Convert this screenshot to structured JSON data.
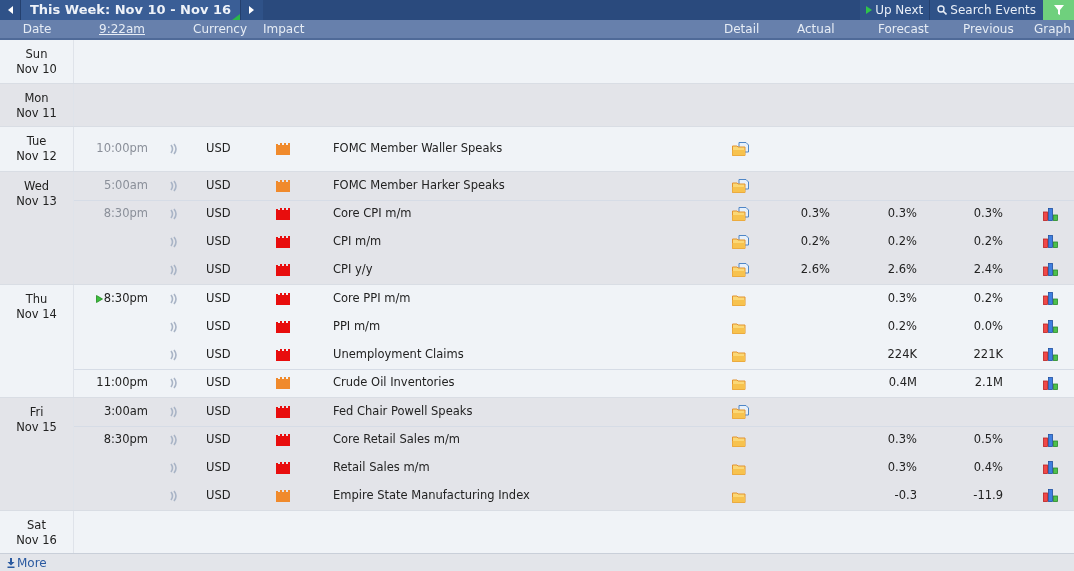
{
  "toolbar": {
    "week_label": "This Week: Nov 10 - Nov 16",
    "up_next": "Up Next",
    "search": "Search Events"
  },
  "columns": {
    "date": "Date",
    "time": "9:22am",
    "currency": "Currency",
    "impact": "Impact",
    "detail": "Detail",
    "actual": "Actual",
    "forecast": "Forecast",
    "previous": "Previous",
    "graph": "Graph"
  },
  "days": [
    {
      "day": "Sun",
      "date": "Nov 10"
    },
    {
      "day": "Mon",
      "date": "Nov 11"
    },
    {
      "day": "Tue",
      "date": "Nov 12",
      "events": [
        {
          "kind": "news",
          "time": "10:00pm",
          "past": true,
          "next": false,
          "currency": "USD",
          "color": "#f08a2c",
          "title": "FOMC Member Waller Speaks",
          "graph": false
        }
      ]
    },
    {
      "day": "Wed",
      "date": "Nov 13",
      "events": [
        {
          "kind": "news",
          "time": "5:00am",
          "past": true,
          "next": false,
          "currency": "USD",
          "color": "#f08a2c",
          "title": "FOMC Member Harker Speaks",
          "graph": false
        },
        {
          "kind": "news",
          "time": "8:30pm",
          "past": true,
          "next": false,
          "currency": "USD",
          "color": "#e80d0d",
          "title": "Core CPI m/m",
          "actual": "0.3%",
          "forecast": "0.3%",
          "previous": "0.3%",
          "graph": true
        },
        {
          "kind": "news",
          "next": false,
          "currency": "USD",
          "color": "#e80d0d",
          "title": "CPI m/m",
          "actual": "0.2%",
          "forecast": "0.2%",
          "previous": "0.2%",
          "graph": true
        },
        {
          "kind": "news",
          "next": false,
          "currency": "USD",
          "color": "#e80d0d",
          "title": "CPI y/y",
          "actual": "2.6%",
          "forecast": "2.6%",
          "previous": "2.4%",
          "graph": true
        }
      ]
    },
    {
      "day": "Thu",
      "date": "Nov 14",
      "events": [
        {
          "kind": "folder",
          "time": "8:30pm",
          "past": false,
          "next": true,
          "currency": "USD",
          "color": "#e80d0d",
          "title": "Core PPI m/m",
          "forecast": "0.3%",
          "previous": "0.2%",
          "graph": true
        },
        {
          "kind": "folder",
          "next": false,
          "currency": "USD",
          "color": "#e80d0d",
          "title": "PPI m/m",
          "forecast": "0.2%",
          "previous": "0.0%",
          "graph": true
        },
        {
          "kind": "folder",
          "next": false,
          "currency": "USD",
          "color": "#e80d0d",
          "title": "Unemployment Claims",
          "forecast": "224K",
          "previous": "221K",
          "graph": true
        },
        {
          "kind": "folder",
          "time": "11:00pm",
          "past": false,
          "next": false,
          "currency": "USD",
          "color": "#f08a2c",
          "title": "Crude Oil Inventories",
          "forecast": "0.4M",
          "previous": "2.1M",
          "graph": true
        }
      ]
    },
    {
      "day": "Fri",
      "date": "Nov 15",
      "events": [
        {
          "kind": "news",
          "time": "3:00am",
          "past": false,
          "next": false,
          "currency": "USD",
          "color": "#e80d0d",
          "title": "Fed Chair Powell Speaks",
          "graph": false
        },
        {
          "kind": "folder",
          "time": "8:30pm",
          "past": false,
          "next": false,
          "currency": "USD",
          "color": "#e80d0d",
          "title": "Core Retail Sales m/m",
          "forecast": "0.3%",
          "previous": "0.5%",
          "graph": true
        },
        {
          "kind": "folder",
          "next": false,
          "currency": "USD",
          "color": "#e80d0d",
          "title": "Retail Sales m/m",
          "forecast": "0.3%",
          "previous": "0.4%",
          "graph": true
        },
        {
          "kind": "folder",
          "next": false,
          "currency": "USD",
          "color": "#f08a2c",
          "title": "Empire State Manufacturing Index",
          "forecast": "-0.3",
          "previous": "-11.9",
          "graph": true
        }
      ]
    },
    {
      "day": "Sat",
      "date": "Nov 16"
    }
  ],
  "more": "More"
}
